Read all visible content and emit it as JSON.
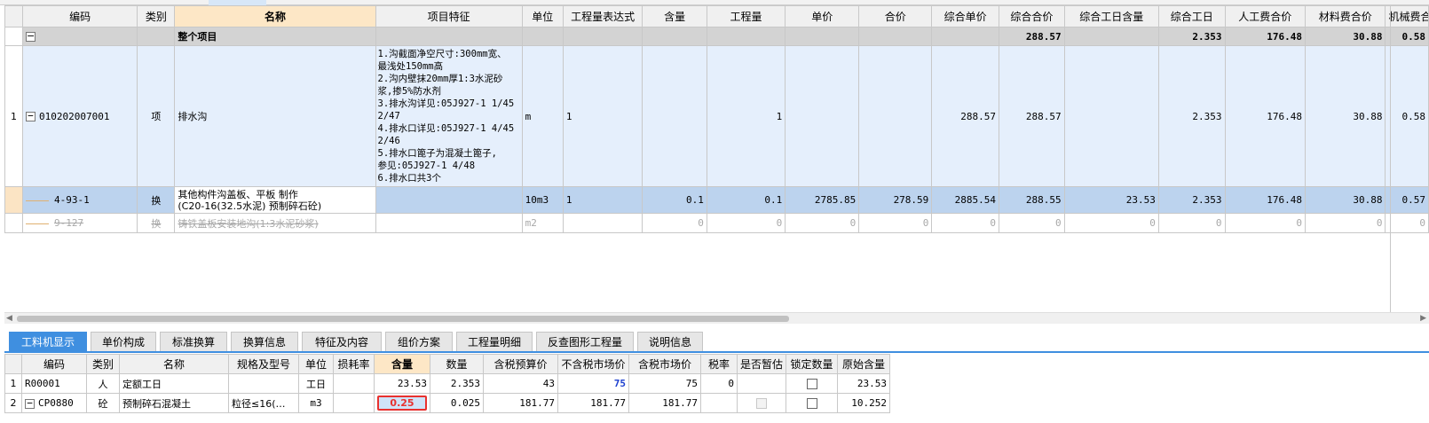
{
  "main_table": {
    "headers": [
      "编码",
      "类别",
      "名称",
      "项目特征",
      "单位",
      "工程量表达式",
      "含量",
      "工程量",
      "单价",
      "合价",
      "综合单价",
      "综合合价",
      "综合工日含量",
      "综合工日",
      "人工费合价",
      "材料费合价",
      "机械费合价"
    ],
    "total_row": {
      "toggle": "−",
      "name": "整个项目",
      "comprehensive_total": "288.57",
      "labor_days": "2.353",
      "labor_cost": "176.48",
      "material_cost": "30.88",
      "machine_cost": "0.58"
    },
    "item_row": {
      "row_no": "1",
      "toggle": "−",
      "code": "010202007001",
      "category": "项",
      "name": "排水沟",
      "feature_lines": [
        "1.沟截面净空尺寸:300mm宽、",
        "最浅处150mm高",
        "2.沟内壁抹20mm厚1:3水泥砂",
        "浆,掺5%防水剂",
        "3.排水沟详见:05J927-1 1/45",
        "2/47",
        "4.排水口详见:05J927-1 4/45",
        "2/46",
        "5.排水口篦子为混凝土篦子,",
        "参见:05J927-1 4/48",
        "6.排水口共3个"
      ],
      "unit": "m",
      "expression": "1",
      "quantity": "1",
      "comprehensive_unit_price": "288.57",
      "comprehensive_total": "288.57",
      "labor_days": "2.353",
      "labor_cost": "176.48",
      "material_cost": "30.88",
      "machine_cost": "0.58"
    },
    "sub_row": {
      "code": "4-93-1",
      "category": "换",
      "name_lines": [
        "其他构件沟盖板、平板 制作",
        "(C20-16(32.5水泥) 预制碎石砼)"
      ],
      "unit": "10m3",
      "expression": "1",
      "content": "0.1",
      "quantity": "0.1",
      "unit_price": "2785.85",
      "total_price": "278.59",
      "comprehensive_unit_price": "2885.54",
      "comprehensive_total": "288.55",
      "labor_day_content": "23.53",
      "labor_days": "2.353",
      "labor_cost": "176.48",
      "material_cost": "30.88",
      "machine_cost": "0.57"
    },
    "deleted_row": {
      "code": "9-127",
      "category": "换",
      "name": "铸铁盖板安装地沟(1:3水泥砂浆)",
      "unit": "m2",
      "zero": "0"
    }
  },
  "tabs": [
    "工料机显示",
    "单价构成",
    "标准换算",
    "换算信息",
    "特征及内容",
    "组价方案",
    "工程量明细",
    "反查图形工程量",
    "说明信息"
  ],
  "resource_table": {
    "headers": [
      "编码",
      "类别",
      "名称",
      "规格及型号",
      "单位",
      "损耗率",
      "含量",
      "数量",
      "含税预算价",
      "不含税市场价",
      "含税市场价",
      "税率",
      "是否暂估",
      "锁定数量",
      "原始含量"
    ],
    "rows": [
      {
        "no": "1",
        "code": "R00001",
        "category": "人",
        "name": "定额工日",
        "spec": "",
        "unit": "工日",
        "loss": "",
        "content": "23.53",
        "quantity": "2.353",
        "budget_price": "43",
        "market_price_ex": "75",
        "market_price": "75",
        "tax": "0",
        "original": "23.53"
      },
      {
        "no": "2",
        "toggle": "−",
        "code": "CP0880",
        "category": "砼",
        "name": "预制碎石混凝土",
        "spec": "粒径≤16(…",
        "unit": "m3",
        "loss": "",
        "content": "0.25",
        "quantity": "0.025",
        "budget_price": "181.77",
        "market_price_ex": "181.77",
        "market_price": "181.77",
        "tax": "",
        "original": "10.252"
      }
    ]
  },
  "colors": {
    "accent": "#3f8fe0",
    "selected_row": "#bcd3ee",
    "item_row": "#e5effc",
    "highlight_header": "#fde7c6",
    "edit_border": "#e8312f"
  }
}
